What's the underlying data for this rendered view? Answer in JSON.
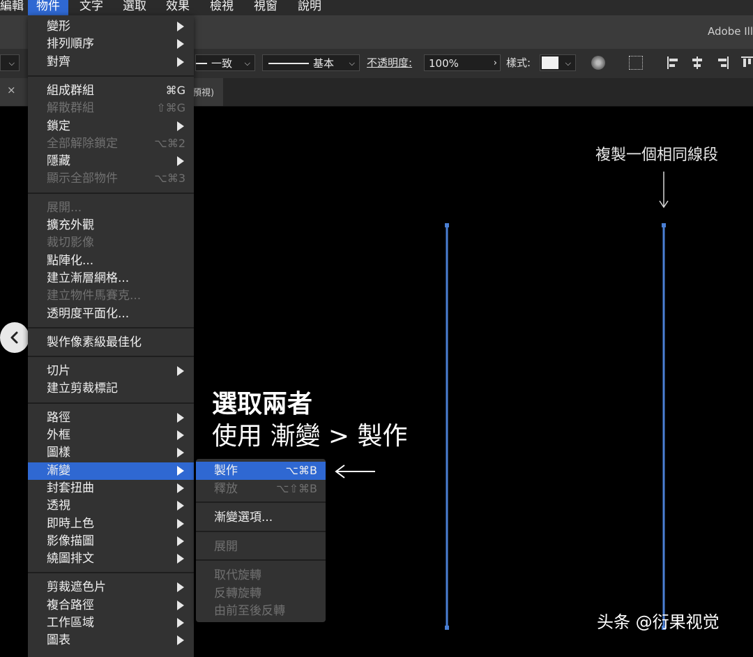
{
  "menubar": {
    "items": [
      "編輯",
      "物件",
      "文字",
      "選取",
      "效果",
      "檢視",
      "視窗",
      "說明"
    ],
    "active_index": 1
  },
  "toolbar": {
    "app_title": "Adobe Ill",
    "stroke_profile": "一致",
    "brush": "基本",
    "opacity_label": "不透明度:",
    "opacity_value": "100%",
    "style_label": "樣式:",
    "tab_title": "預視)"
  },
  "object_menu": {
    "items": [
      {
        "label": "變形",
        "submenu": true,
        "enabled": true
      },
      {
        "label": "排列順序",
        "submenu": true,
        "enabled": true
      },
      {
        "label": "對齊",
        "submenu": true,
        "enabled": true
      },
      {
        "sep": true
      },
      {
        "label": "組成群組",
        "shortcut": "⌘G",
        "enabled": true
      },
      {
        "label": "解散群組",
        "shortcut": "⇧⌘G",
        "enabled": false
      },
      {
        "label": "鎖定",
        "submenu": true,
        "enabled": true
      },
      {
        "label": "全部解除鎖定",
        "shortcut": "⌥⌘2",
        "enabled": false
      },
      {
        "label": "隱藏",
        "submenu": true,
        "enabled": true
      },
      {
        "label": "顯示全部物件",
        "shortcut": "⌥⌘3",
        "enabled": false
      },
      {
        "sep": true
      },
      {
        "label": "展開...",
        "enabled": false
      },
      {
        "label": "擴充外觀",
        "enabled": true
      },
      {
        "label": "裁切影像",
        "enabled": false
      },
      {
        "label": "點陣化...",
        "enabled": true
      },
      {
        "label": "建立漸層網格...",
        "enabled": true
      },
      {
        "label": "建立物件馬賽克...",
        "enabled": false
      },
      {
        "label": "透明度平面化...",
        "enabled": true
      },
      {
        "sep": true
      },
      {
        "label": "製作像素級最佳化",
        "enabled": true
      },
      {
        "sep": true
      },
      {
        "label": "切片",
        "submenu": true,
        "enabled": true
      },
      {
        "label": "建立剪裁標記",
        "enabled": true
      },
      {
        "sep": true
      },
      {
        "label": "路徑",
        "submenu": true,
        "enabled": true
      },
      {
        "label": "外框",
        "submenu": true,
        "enabled": true
      },
      {
        "label": "圖樣",
        "submenu": true,
        "enabled": true
      },
      {
        "label": "漸變",
        "submenu": true,
        "enabled": true,
        "highlight": true
      },
      {
        "label": "封套扭曲",
        "submenu": true,
        "enabled": true
      },
      {
        "label": "透視",
        "submenu": true,
        "enabled": true
      },
      {
        "label": "即時上色",
        "submenu": true,
        "enabled": true
      },
      {
        "label": "影像描圖",
        "submenu": true,
        "enabled": true
      },
      {
        "label": "繞圖排文",
        "submenu": true,
        "enabled": true
      },
      {
        "sep": true
      },
      {
        "label": "剪裁遮色片",
        "submenu": true,
        "enabled": true
      },
      {
        "label": "複合路徑",
        "submenu": true,
        "enabled": true
      },
      {
        "label": "工作區域",
        "submenu": true,
        "enabled": true
      },
      {
        "label": "圖表",
        "submenu": true,
        "enabled": true
      }
    ]
  },
  "blend_submenu": {
    "items": [
      {
        "label": "製作",
        "shortcut": "⌥⌘B",
        "enabled": true,
        "highlight": true
      },
      {
        "label": "釋放",
        "shortcut": "⌥⇧⌘B",
        "enabled": false
      },
      {
        "sep": true
      },
      {
        "label": "漸變選項...",
        "enabled": true
      },
      {
        "sep": true
      },
      {
        "label": "展開",
        "enabled": false
      },
      {
        "sep": true
      },
      {
        "label": "取代旋轉",
        "enabled": false
      },
      {
        "label": "反轉旋轉",
        "enabled": false
      },
      {
        "label": "由前至後反轉",
        "enabled": false
      }
    ]
  },
  "annotations": {
    "step_line1": "選取兩者",
    "step_line2": "使用 漸變 > 製作",
    "duplicate_note": "複製一個相同線段",
    "watermark": "头条 @衍果视觉"
  },
  "colors": {
    "menu_highlight": "#2f68d2",
    "path_selection": "#4a7fd4",
    "menu_bg": "#323232"
  }
}
